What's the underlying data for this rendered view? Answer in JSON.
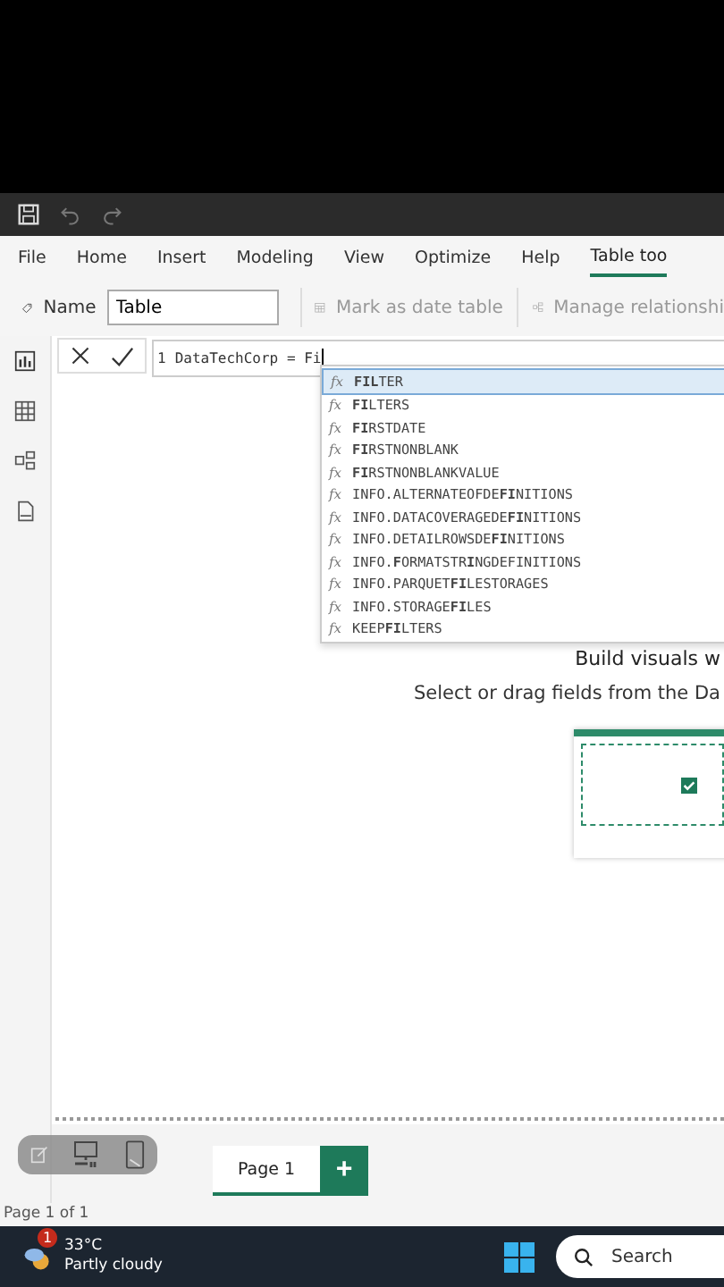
{
  "menu": [
    {
      "label": "File",
      "selected": false
    },
    {
      "label": "Home",
      "selected": false
    },
    {
      "label": "Insert",
      "selected": false
    },
    {
      "label": "Modeling",
      "selected": false
    },
    {
      "label": "View",
      "selected": false
    },
    {
      "label": "Optimize",
      "selected": false
    },
    {
      "label": "Help",
      "selected": false
    },
    {
      "label": "Table too",
      "selected": true
    }
  ],
  "toolbar": {
    "name_label": "Name",
    "name_value": "Table",
    "mark_date": "Mark as date table",
    "manage": "Manage relationshi"
  },
  "formula": {
    "line_number": "1",
    "text": "DataTechCorp = Fi"
  },
  "suggestions": [
    {
      "icon": "fx",
      "text": "**FIL**TER",
      "selected": true
    },
    {
      "icon": "fx",
      "text": "**FI**LTERS",
      "selected": false
    },
    {
      "icon": "fx",
      "text": "**FI**RSTDATE",
      "selected": false
    },
    {
      "icon": "fx",
      "text": "**FI**RSTNONBLANK",
      "selected": false
    },
    {
      "icon": "fx",
      "text": "**FI**RSTNONBLANKVALUE",
      "selected": false
    },
    {
      "icon": "fx",
      "text": "INFO.ALTERNATEOFDE**FI**NITIONS",
      "selected": false
    },
    {
      "icon": "fx",
      "text": "INFO.DATACOVERAGEDE**FI**NITIONS",
      "selected": false
    },
    {
      "icon": "fx",
      "text": "INFO.DETAILROWSDE**FI**NITIONS",
      "selected": false
    },
    {
      "icon": "fx",
      "text": "INFO.**F**ORMATSTR**I**NGDEFINITIONS",
      "selected": false
    },
    {
      "icon": "fx",
      "text": "INFO.PARQUET**FI**LESTORAGES",
      "selected": false
    },
    {
      "icon": "fx",
      "text": "INFO.STORAGE**FI**LES",
      "selected": false
    },
    {
      "icon": "fx",
      "text": "KEEP**FI**LTERS",
      "selected": false
    }
  ],
  "canvas": {
    "heading": "Build visuals w",
    "subtext": "Select or drag fields from the Da"
  },
  "pages": [
    {
      "label": "Page 1",
      "selected": true
    }
  ],
  "add_page": "+",
  "status": "Page 1 of 1",
  "taskbar": {
    "badge": "1",
    "temperature": "33°C",
    "weather": "Partly cloudy",
    "search_placeholder": "Search"
  }
}
